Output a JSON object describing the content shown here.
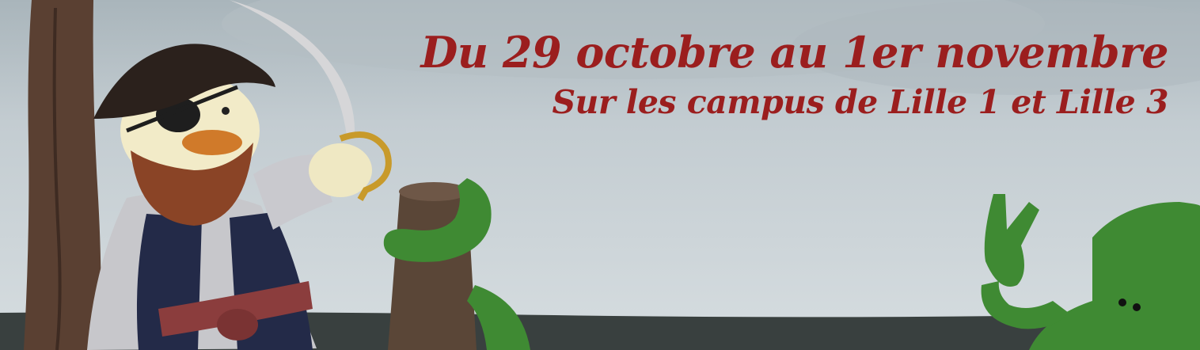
{
  "banner": {
    "headline_dates": "Du 29 octobre au 1er novembre",
    "headline_location": "Sur les campus de Lille 1 et Lille 3",
    "colors": {
      "headline": "#9b1e1e",
      "sky": "#c9d2d6",
      "sea": "#39403f",
      "green_creatures": "#3f8a33"
    },
    "scene_elements": [
      "tree-trunk",
      "pirate-duck",
      "cutlass",
      "wooden-post",
      "green-tentacle",
      "green-octopus"
    ]
  }
}
